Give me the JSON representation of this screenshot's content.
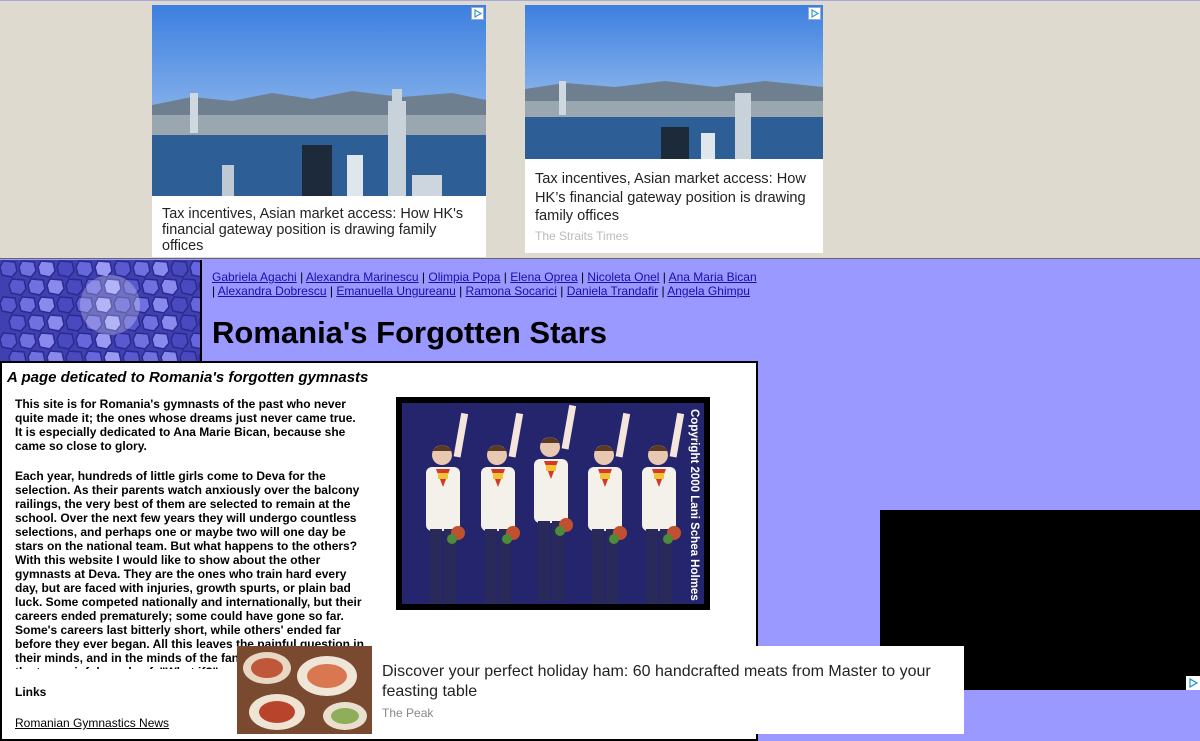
{
  "ads": {
    "top_left": {
      "headline": "Tax incentives, Asian market access: How HK's financial gateway position is drawing family offices"
    },
    "top_right": {
      "headline": "Tax incentives, Asian market access: How HK’s financial gateway position is drawing family offices",
      "source": "The Straits Times"
    },
    "bottom": {
      "headline": "Discover your perfect holiday ham: 60 handcrafted meats from Master to your feasting table",
      "source": "The Peak"
    },
    "adchoices_icon": "adchoices-icon"
  },
  "header": {
    "gymnast_links": [
      "Gabriela Agachi",
      "Alexandra Marinescu",
      "Olimpia Popa",
      "Elena Oprea",
      "Nicoleta Onel",
      "Ana Maria Bican",
      "Alexandra Dobrescu",
      "Emanuella Ungureanu",
      "Ramona Socarici",
      "Daniela Trandafir",
      "Angela Ghimpu"
    ],
    "separator": " | ",
    "title": "Romania's Forgotten Stars"
  },
  "content": {
    "subtitle": "A page deticated to Romania's forgotten gymnasts",
    "paragraph1": "This site is for Romania's gymnasts of the past who never quite made it; the ones whose dreams just never came true. It is especially dedicated to Ana Marie Bican, because she came so close to glory.",
    "paragraph2": "Each year, hundreds of little girls come to Deva for the selection. As their parents watch anxiously over the balcony railings, the very best of them are selected to remain at the school. Over the next few years they will undergo countless selections, and perhaps one or maybe two will one day be stars on the national team. But what happens to the others? With this website I would like to show about the other gymnasts at Deva. They are the ones who train hard every day, but are faced with injuries, growth spurts, or plain bad luck. Some competed nationally and internationally, but their careers ended prematurely; some could have gone so far. Some's careers last bitterly short, while others' ended far before they ever began. All this leaves the painful question in their minds, and in the minds of the fans of these gymnasts, the two painful words of, \"What if?\"",
    "links_heading": "Links",
    "news_link": "Romanian Gymnastics News",
    "photo_caption": "Copyright 2000 Lani Schea Holmes"
  },
  "colors": {
    "page_bg": "#9999ff",
    "top_bg": "#dedad0",
    "link": "#1a0dab"
  }
}
